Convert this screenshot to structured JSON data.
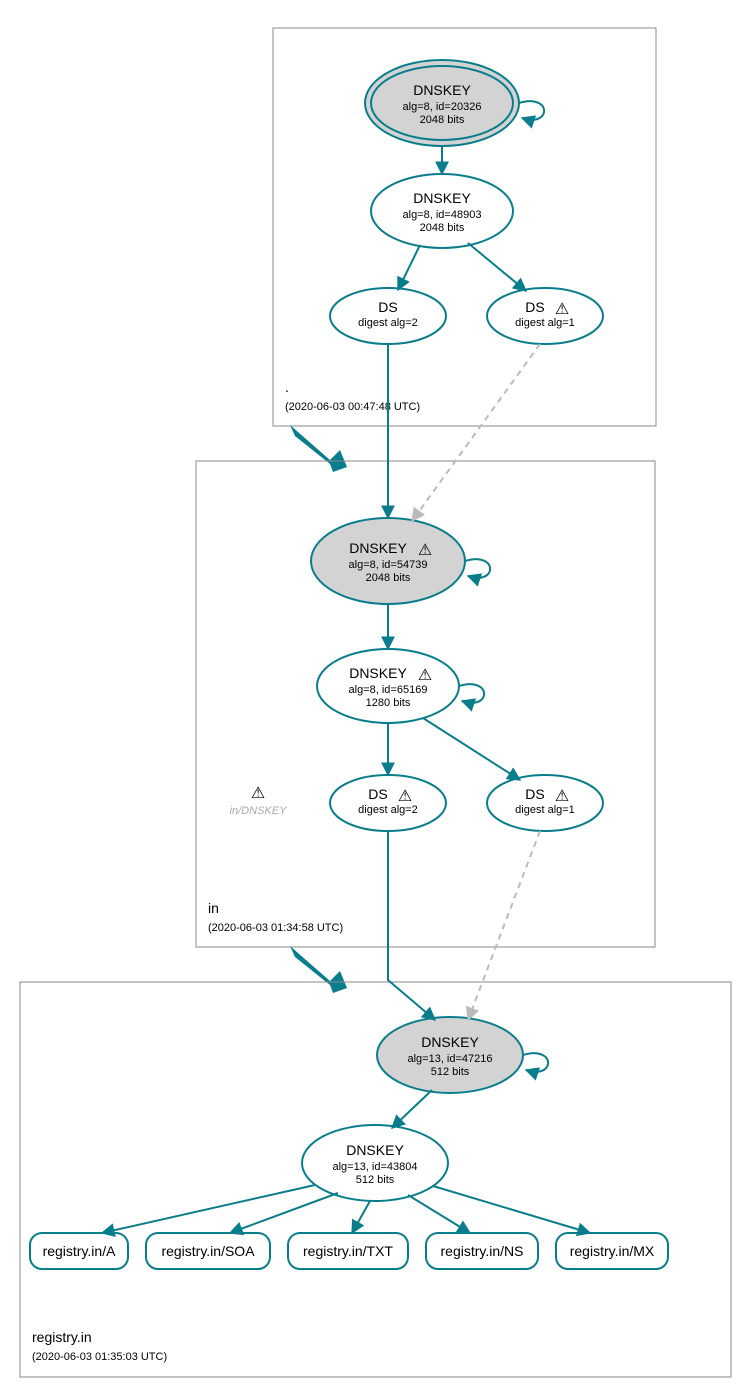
{
  "colors": {
    "accent": "#0a7d8c",
    "node_grey": "#d3d3d3",
    "dashed": "#bbbbbb"
  },
  "zones": {
    "root": {
      "label": ".",
      "timestamp": "(2020-06-03 00:47:48 UTC)"
    },
    "in": {
      "label": "in",
      "timestamp": "(2020-06-03 01:34:58 UTC)"
    },
    "registry": {
      "label": "registry.in",
      "timestamp": "(2020-06-03 01:35:03 UTC)"
    }
  },
  "nodes": {
    "root_ksk": {
      "title": "DNSKEY",
      "l1": "alg=8, id=20326",
      "l2": "2048 bits"
    },
    "root_zsk": {
      "title": "DNSKEY",
      "l1": "alg=8, id=48903",
      "l2": "2048 bits"
    },
    "root_ds2": {
      "title": "DS",
      "l1": "digest alg=2"
    },
    "root_ds1": {
      "title": "DS",
      "l1": "digest alg=1"
    },
    "in_ksk": {
      "title": "DNSKEY",
      "l1": "alg=8, id=54739",
      "l2": "2048 bits"
    },
    "in_zsk": {
      "title": "DNSKEY",
      "l1": "alg=8, id=65169",
      "l2": "1280 bits"
    },
    "in_ds2": {
      "title": "DS",
      "l1": "digest alg=2"
    },
    "in_ds1": {
      "title": "DS",
      "l1": "digest alg=1"
    },
    "reg_ksk": {
      "title": "DNSKEY",
      "l1": "alg=13, id=47216",
      "l2": "512 bits"
    },
    "reg_zsk": {
      "title": "DNSKEY",
      "l1": "alg=13, id=43804",
      "l2": "512 bits"
    },
    "rr_a": {
      "title": "registry.in/A"
    },
    "rr_soa": {
      "title": "registry.in/SOA"
    },
    "rr_txt": {
      "title": "registry.in/TXT"
    },
    "rr_ns": {
      "title": "registry.in/NS"
    },
    "rr_mx": {
      "title": "registry.in/MX"
    }
  },
  "ghost_label": "in/DNSKEY",
  "warn": "⚠"
}
